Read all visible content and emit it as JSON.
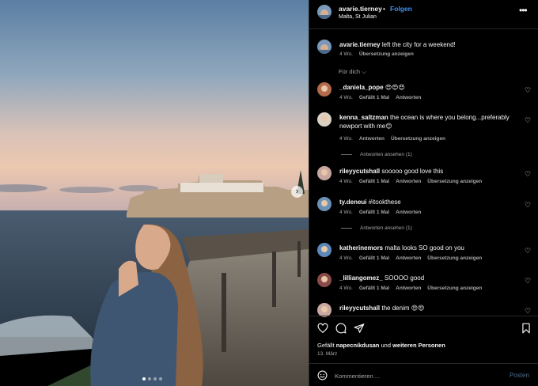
{
  "header": {
    "username": "avarie.tierney",
    "separator": "•",
    "follow_label": "Folgen",
    "location": "Malta, St Julian",
    "more_label": "•••"
  },
  "caption": {
    "username": "avarie.tierney",
    "text": "left the city for a weekend!",
    "time": "4 Wo.",
    "translate": "Übersetzung anzeigen"
  },
  "filter": {
    "label": "Für dich ⌵"
  },
  "comments": [
    {
      "user": "_daniela_pope",
      "text": "😍😍😍",
      "time": "4 Wo.",
      "likes": "Gefällt 1 Mal",
      "reply": "Antworten",
      "translate": "",
      "avatar_color": "#b36a4a"
    },
    {
      "user": "kenna_saltzman",
      "text": "the ocean is where you belong...preferably newport with me😊",
      "time": "4 Wo.",
      "likes": "",
      "reply": "Antworten",
      "translate": "Übersetzung anzeigen",
      "avatar_color": "#d9cfc2",
      "replies": "Antworten ansehen (1)"
    },
    {
      "user": "rileyycutshall",
      "text": "sooooo good love this",
      "time": "4 Wo.",
      "likes": "Gefällt 1 Mal",
      "reply": "Antworten",
      "translate": "Übersetzung anzeigen",
      "avatar_color": "#c9a6a0"
    },
    {
      "user": "ty.deneui",
      "text": "#itookthese",
      "time": "4 Wo.",
      "likes": "Gefällt 1 Mal",
      "reply": "Antworten",
      "translate": "",
      "avatar_color": "#6b8fb5",
      "replies": "Antworten ansehen (1)"
    },
    {
      "user": "katherinemors",
      "text": "malta looks SO good on you",
      "time": "4 Wo.",
      "likes": "Gefällt 1 Mal",
      "reply": "Antworten",
      "translate": "Übersetzung anzeigen",
      "avatar_color": "#5b88b8"
    },
    {
      "user": "_lilliangomez_",
      "text": "SOOOO good",
      "time": "4 Wo.",
      "likes": "Gefällt 1 Mal",
      "reply": "Antworten",
      "translate": "Übersetzung anzeigen",
      "avatar_color": "#8a4a4a"
    },
    {
      "user": "rileyycutshall",
      "text": "the denim 😍😍",
      "time": "",
      "likes": "",
      "reply": "",
      "translate": "",
      "avatar_color": "#c9a6a0"
    }
  ],
  "actions": {
    "liked_prefix": "Gefällt",
    "liked_user": "napecnikdusan",
    "liked_mid": "und",
    "liked_others": "weiteren Personen",
    "date": "13. März"
  },
  "comment_input": {
    "placeholder": "Kommentieren ...",
    "post_label": "Posten"
  },
  "carousel": {
    "next_label": "›",
    "slide_count": 4,
    "active_index": 0
  }
}
